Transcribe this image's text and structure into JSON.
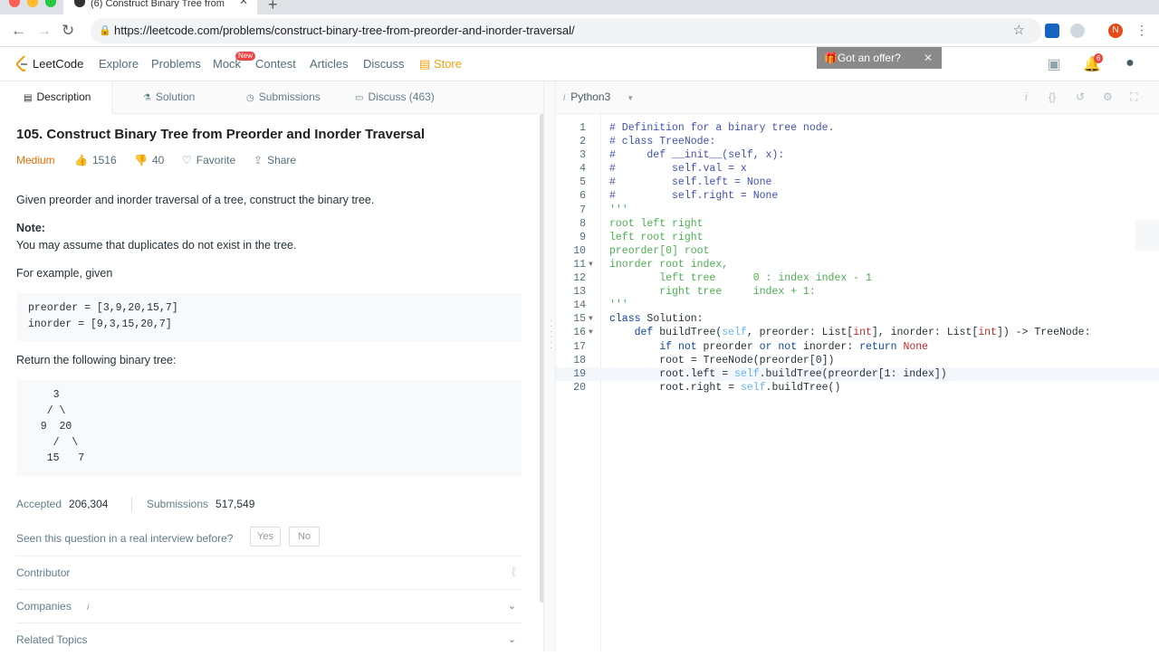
{
  "browser": {
    "tab_title": "(6) Construct Binary Tree from",
    "url": "https://leetcode.com/problems/construct-binary-tree-from-preorder-and-inorder-traversal/",
    "profile_initial": "N",
    "colors": {
      "red": "#ff5f57",
      "yellow": "#febc2e",
      "green": "#28c840"
    }
  },
  "nav": {
    "brand": "LeetCode",
    "links": [
      "Explore",
      "Problems",
      "Mock",
      "Contest",
      "Articles",
      "Discuss",
      "Store"
    ],
    "new_badge": "New",
    "offer": "Got an offer?",
    "notif_count": "6"
  },
  "left_tabs": [
    "Description",
    "Solution",
    "Submissions",
    "Discuss (463)"
  ],
  "problem": {
    "title": "105. Construct Binary Tree from Preorder and Inorder Traversal",
    "difficulty": "Medium",
    "likes": "1516",
    "dislikes": "40",
    "favorite": "Favorite",
    "share": "Share",
    "statement": "Given preorder and inorder traversal of a tree, construct the binary tree.",
    "note_label": "Note:",
    "note": "You may assume that duplicates do not exist in the tree.",
    "example_label": "For example, given",
    "example": "preorder = [3,9,20,15,7]\ninorder = [9,3,15,20,7]",
    "return_label": "Return the following binary tree:",
    "tree": "    3\n   / \\\n  9  20\n    /  \\\n   15   7",
    "accepted_label": "Accepted",
    "accepted": "206,304",
    "submissions_label": "Submissions",
    "submissions": "517,549",
    "seen": "Seen this question in a real interview before?",
    "yes": "Yes",
    "no": "No",
    "sections": [
      "Contributor",
      "Companies",
      "Related Topics"
    ]
  },
  "editor": {
    "language": "Python3",
    "lines": [
      "# Definition for a binary tree node.",
      "# class TreeNode:",
      "#     def __init__(self, x):",
      "#         self.val = x",
      "#         self.left = None",
      "#         self.right = None",
      "'''",
      "root left right",
      "left root right",
      "preorder[0] root",
      "inorder root index,",
      "        left tree      0 : index index - 1",
      "        right tree     index + 1:",
      "'''",
      "class Solution:",
      "    def buildTree(self, preorder: List[int], inorder: List[int]) -> TreeNode:",
      "        if not preorder or not inorder: return None",
      "        root = TreeNode(preorder[0])",
      "        root.left = self.buildTree(preorder[1: index])",
      "        root.right = self.buildTree()"
    ]
  }
}
